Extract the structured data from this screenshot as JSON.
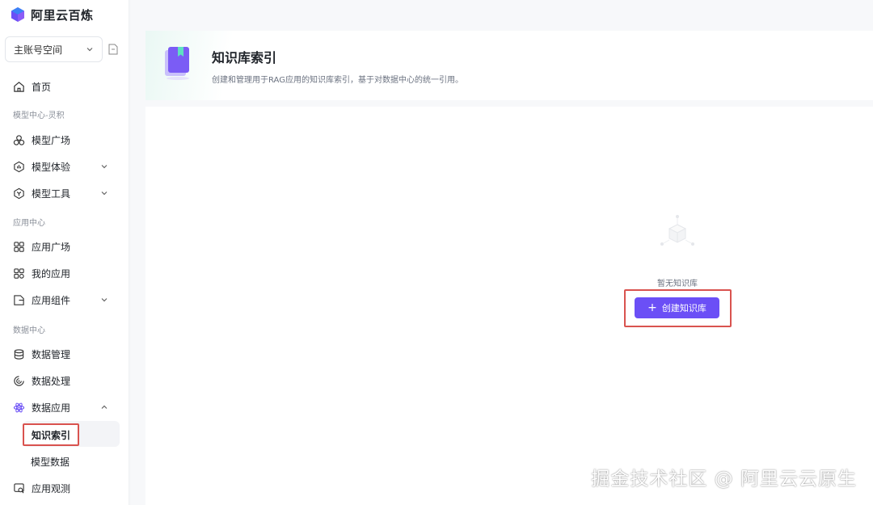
{
  "app": {
    "name": "阿里云百炼"
  },
  "workspace": {
    "label": "主账号空间"
  },
  "sidebar": {
    "home": "首页",
    "sections": {
      "model_center": "模型中心-灵积",
      "app_center": "应用中心",
      "data_center": "数据中心"
    },
    "items": {
      "model_square": "模型广场",
      "model_experience": "模型体验",
      "model_tools": "模型工具",
      "app_square": "应用广场",
      "my_apps": "我的应用",
      "app_components": "应用组件",
      "data_management": "数据管理",
      "data_processing": "数据处理",
      "data_apps": "数据应用",
      "knowledge_index": "知识索引",
      "model_data": "模型数据",
      "app_observation": "应用观测"
    }
  },
  "page": {
    "title": "知识库索引",
    "description": "创建和管理用于RAG应用的知识库索引，基于对数据中心的统一引用。",
    "empty_text": "暂无知识库",
    "create_button": "创建知识库"
  },
  "watermark": "掘金技术社区 @ 阿里云云原生",
  "colors": {
    "primary": "#6b4ff6",
    "highlight_border": "#d9534f"
  }
}
